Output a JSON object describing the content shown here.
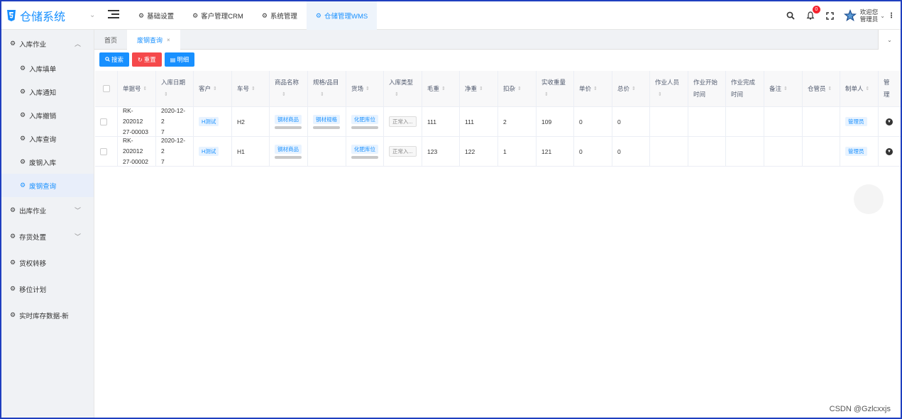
{
  "app": {
    "title": "仓储系统"
  },
  "top_tabs": [
    {
      "label": "基础设置"
    },
    {
      "label": "客户管理CRM"
    },
    {
      "label": "系统管理"
    },
    {
      "label": "仓储管理WMS"
    }
  ],
  "header": {
    "notification_count": "0",
    "welcome_line1": "欢迎您",
    "welcome_line2": "管理员"
  },
  "sidebar": {
    "items": [
      {
        "label": "入库作业"
      },
      {
        "label": "入库填单"
      },
      {
        "label": "入库通知"
      },
      {
        "label": "入库撤销"
      },
      {
        "label": "入库查询"
      },
      {
        "label": "废钢入库"
      },
      {
        "label": "废钢查询"
      },
      {
        "label": "出库作业"
      },
      {
        "label": "存货处置"
      },
      {
        "label": "货权转移"
      },
      {
        "label": "移位计划"
      },
      {
        "label": "实时库存数据-新"
      }
    ]
  },
  "page_tabs": [
    {
      "label": "首页"
    },
    {
      "label": "废钢查询"
    }
  ],
  "toolbar": {
    "search_label": "搜索",
    "reset_label": "重置",
    "detail_label": "明细"
  },
  "table": {
    "columns": [
      "单据号",
      "入库日期",
      "客户",
      "车号",
      "商品名称",
      "规格/品目",
      "货场",
      "入库类型",
      "毛重",
      "净重",
      "扣杂",
      "实收重量",
      "单价",
      "总价",
      "作业人员",
      "作业开始时间",
      "作业完成时间",
      "备注",
      "仓管员",
      "制单人",
      "管理"
    ],
    "rows": [
      {
        "doc_no_1": "RK-202012",
        "doc_no_2": "27-00003",
        "date_1": "2020-12-2",
        "date_2": "7",
        "customer": "H测试",
        "plate": "H2",
        "product": "钢材商品",
        "spec": "钢材规格",
        "yard": "化肥库位",
        "type": "正常入...",
        "gross": "111",
        "net": "111",
        "deduct": "2",
        "actual": "109",
        "price": "0",
        "total": "0",
        "maker": "管理员"
      },
      {
        "doc_no_1": "RK-202012",
        "doc_no_2": "27-00002",
        "date_1": "2020-12-2",
        "date_2": "7",
        "customer": "H测试",
        "plate": "H1",
        "product": "钢材商品",
        "spec": "",
        "yard": "化肥库位",
        "type": "正常入...",
        "gross": "123",
        "net": "122",
        "deduct": "1",
        "actual": "121",
        "price": "0",
        "total": "0",
        "maker": "管理员"
      }
    ]
  },
  "watermark": "CSDN @Gzlcxxjs",
  "colors": {
    "accent": "#1890ff",
    "danger": "#f5494b",
    "sidebar_bg": "#f0f2f5"
  }
}
